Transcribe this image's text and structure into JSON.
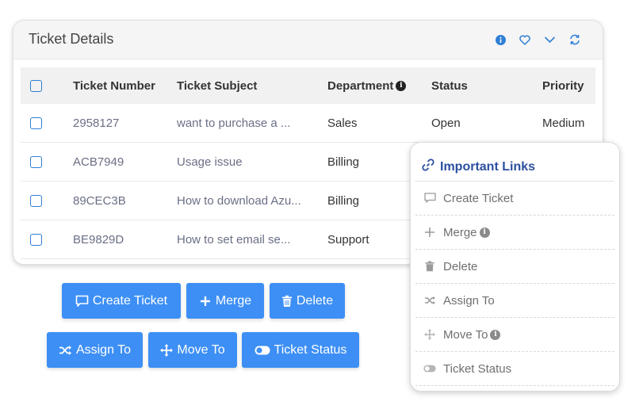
{
  "card": {
    "title": "Ticket Details",
    "header_icons": [
      "info-icon",
      "heart-icon",
      "chevron-down-icon",
      "refresh-icon"
    ]
  },
  "table": {
    "columns": [
      "Ticket Number",
      "Ticket Subject",
      "Department",
      "Status",
      "Priority"
    ],
    "rows": [
      {
        "number": "2958127",
        "subject": "want to purchase a ...",
        "department": "Sales",
        "status": "Open",
        "priority": "Medium"
      },
      {
        "number": "ACB7949",
        "subject": "Usage issue",
        "department": "Billing",
        "status": "",
        "priority": ""
      },
      {
        "number": "89CEC3B",
        "subject": "How to download Azu...",
        "department": "Billing",
        "status": "",
        "priority": ""
      },
      {
        "number": "BE9829D",
        "subject": "How to set email se...",
        "department": "Support",
        "status": "",
        "priority": ""
      }
    ]
  },
  "buttons": {
    "create_ticket": "Create Ticket",
    "merge": "Merge",
    "delete": "Delete",
    "assign_to": "Assign To",
    "move_to": "Move To",
    "ticket_status": "Ticket Status"
  },
  "important_links": {
    "title": "Important Links",
    "items": [
      "Create Ticket",
      "Merge",
      "Delete",
      "Assign To",
      "Move To",
      "Ticket Status"
    ]
  },
  "colors": {
    "accent": "#3d8ff5",
    "checkbox": "#2f7fd6",
    "links_title": "#2b4fa0",
    "link_text": "#6b6f86"
  }
}
